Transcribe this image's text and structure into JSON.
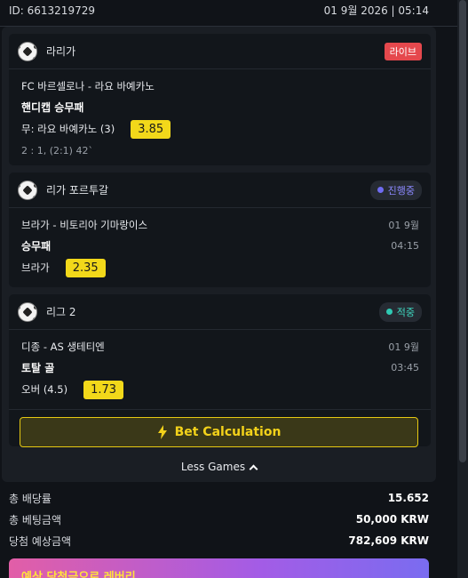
{
  "header": {
    "id_text": "ID: 6613219729",
    "datetime": "01 9월 2026 | 05:14"
  },
  "cards": [
    {
      "league": "라리가",
      "badge": "라이브",
      "match": "FC 바르셀로나 - 라요 바예카노",
      "market": "핸디캡 승무패",
      "pick": "무: 라요 바예카노 (3)",
      "odd": "3.85",
      "score": "2 : 1, (2:1) 42`"
    },
    {
      "league": "리가 포르투갈",
      "status": "진행중",
      "status_color": "#6f6cf2",
      "match": "브라가 - 비토리아 기마랑이스",
      "date": "01 9월",
      "market": "승무패",
      "time": "04:15",
      "pick": "브라가",
      "odd": "2.35"
    },
    {
      "league": "리그 2",
      "status": "적중",
      "status_color": "#2fc9b3",
      "match": "디종 - AS 생테티엔",
      "date": "01 9월",
      "market": "토탈 골",
      "time": "03:45",
      "pick": "오버 (4.5)",
      "odd": "1.73"
    }
  ],
  "bet_calculation_label": "Bet Calculation",
  "less_games_label": "Less Games",
  "summary": [
    {
      "label": "총 배당률",
      "value": "15.652"
    },
    {
      "label": "총 베팅금액",
      "value": "50,000 KRW"
    },
    {
      "label": "당첨 예상금액",
      "value": "782,609 KRW"
    }
  ],
  "promo_text": "예상 당첨금으로 레버리"
}
